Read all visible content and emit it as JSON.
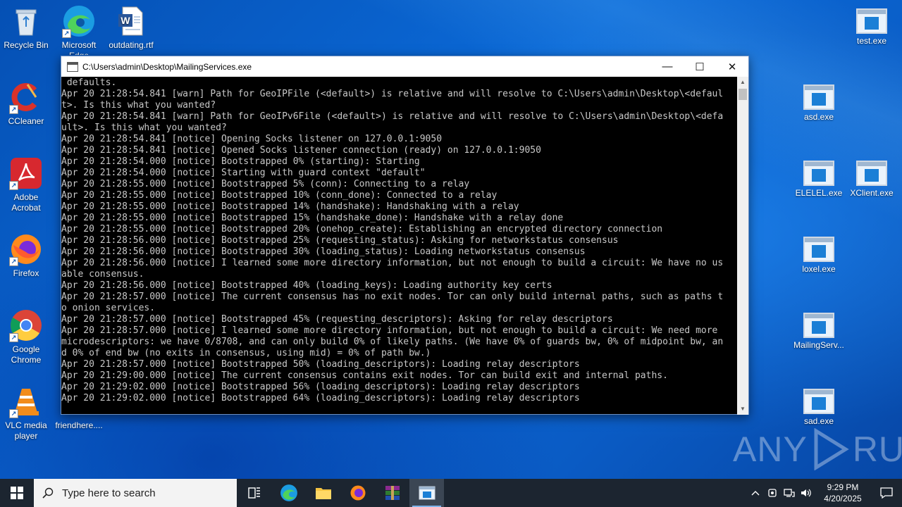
{
  "desktop": {
    "icons_left": [
      {
        "label": "Recycle Bin"
      },
      {
        "label": "Microsoft Edge"
      },
      {
        "label": "outdating.rtf"
      },
      {
        "label": "CCleaner"
      },
      {
        "label": "Adobe Acrobat"
      },
      {
        "label": "Firefox"
      },
      {
        "label": "Google Chrome"
      },
      {
        "label": "VLC media player"
      },
      {
        "label": "friendhere...."
      }
    ],
    "icons_right": [
      {
        "label": "test.exe"
      },
      {
        "label": "asd.exe"
      },
      {
        "label": "ELELEL.exe"
      },
      {
        "label": "XClient.exe"
      },
      {
        "label": "loxel.exe"
      },
      {
        "label": "MailingServ..."
      },
      {
        "label": "sad.exe"
      }
    ],
    "watermark": {
      "left": "ANY",
      "right": "RUN"
    }
  },
  "window": {
    "title": "C:\\Users\\admin\\Desktop\\MailingServices.exe",
    "minimize": "—",
    "maximize": "☐",
    "close": "✕",
    "lines": [
      " defaults.",
      "Apr 20 21:28:54.841 [warn] Path for GeoIPFile (<default>) is relative and will resolve to C:\\Users\\admin\\Desktop\\<defaul",
      "t>. Is this what you wanted?",
      "Apr 20 21:28:54.841 [warn] Path for GeoIPv6File (<default>) is relative and will resolve to C:\\Users\\admin\\Desktop\\<defa",
      "ult>. Is this what you wanted?",
      "Apr 20 21:28:54.841 [notice] Opening Socks listener on 127.0.0.1:9050",
      "Apr 20 21:28:54.841 [notice] Opened Socks listener connection (ready) on 127.0.0.1:9050",
      "Apr 20 21:28:54.000 [notice] Bootstrapped 0% (starting): Starting",
      "Apr 20 21:28:54.000 [notice] Starting with guard context \"default\"",
      "Apr 20 21:28:55.000 [notice] Bootstrapped 5% (conn): Connecting to a relay",
      "Apr 20 21:28:55.000 [notice] Bootstrapped 10% (conn_done): Connected to a relay",
      "Apr 20 21:28:55.000 [notice] Bootstrapped 14% (handshake): Handshaking with a relay",
      "Apr 20 21:28:55.000 [notice] Bootstrapped 15% (handshake_done): Handshake with a relay done",
      "Apr 20 21:28:55.000 [notice] Bootstrapped 20% (onehop_create): Establishing an encrypted directory connection",
      "Apr 20 21:28:56.000 [notice] Bootstrapped 25% (requesting_status): Asking for networkstatus consensus",
      "Apr 20 21:28:56.000 [notice] Bootstrapped 30% (loading_status): Loading networkstatus consensus",
      "Apr 20 21:28:56.000 [notice] I learned some more directory information, but not enough to build a circuit: We have no us",
      "able consensus.",
      "Apr 20 21:28:56.000 [notice] Bootstrapped 40% (loading_keys): Loading authority key certs",
      "Apr 20 21:28:57.000 [notice] The current consensus has no exit nodes. Tor can only build internal paths, such as paths t",
      "o onion services.",
      "Apr 20 21:28:57.000 [notice] Bootstrapped 45% (requesting_descriptors): Asking for relay descriptors",
      "Apr 20 21:28:57.000 [notice] I learned some more directory information, but not enough to build a circuit: We need more",
      "microdescriptors: we have 0/8708, and can only build 0% of likely paths. (We have 0% of guards bw, 0% of midpoint bw, an",
      "d 0% of end bw (no exits in consensus, using mid) = 0% of path bw.)",
      "Apr 20 21:28:57.000 [notice] Bootstrapped 50% (loading_descriptors): Loading relay descriptors",
      "Apr 20 21:29:00.000 [notice] The current consensus contains exit nodes. Tor can build exit and internal paths.",
      "Apr 20 21:29:02.000 [notice] Bootstrapped 56% (loading_descriptors): Loading relay descriptors",
      "Apr 20 21:29:02.000 [notice] Bootstrapped 64% (loading_descriptors): Loading relay descriptors"
    ]
  },
  "taskbar": {
    "search_placeholder": "Type here to search",
    "time": "9:29 PM",
    "date": "4/20/2025"
  }
}
